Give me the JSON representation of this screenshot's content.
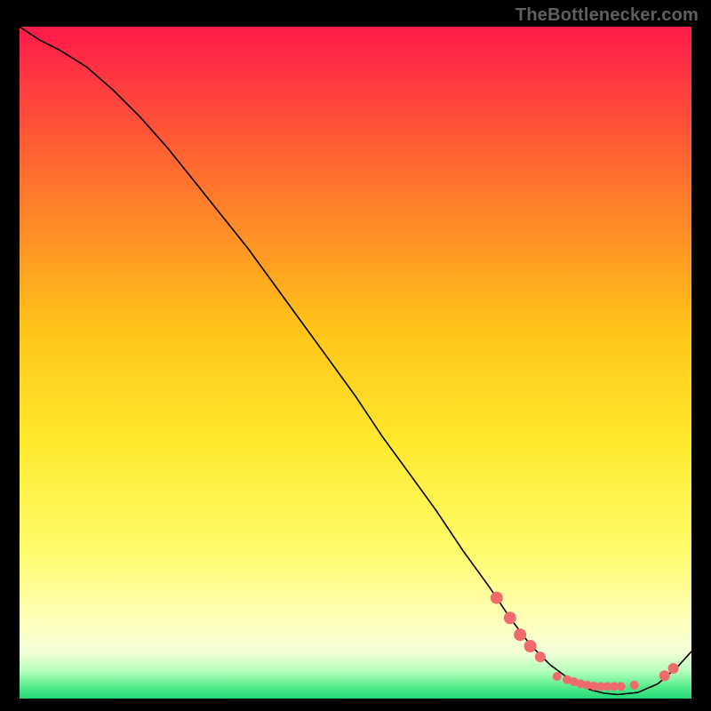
{
  "attribution": "TheBottlenecker.com",
  "chart_data": {
    "type": "line",
    "title": "",
    "xlabel": "",
    "ylabel": "",
    "xlim": [
      0,
      100
    ],
    "ylim": [
      0,
      100
    ],
    "background_gradient": {
      "top": "#ff1a4a",
      "mid1": "#ffb300",
      "mid2": "#ffe000",
      "mid3": "#ffff66",
      "mid4": "#ffffaa",
      "mid5": "#d6ffcc",
      "bottom": "#22d877"
    },
    "series": [
      {
        "name": "curve",
        "x": [
          0,
          3,
          6,
          10,
          14,
          18,
          22,
          26,
          30,
          34,
          38,
          42,
          46,
          50,
          54,
          58,
          62,
          66,
          70,
          73,
          76,
          79,
          81,
          83,
          85,
          87,
          89,
          92,
          95,
          98,
          100
        ],
        "y": [
          100,
          98,
          96.5,
          94,
          90.5,
          86.5,
          82,
          77,
          72,
          67,
          61.5,
          56,
          50.5,
          45,
          39,
          33.5,
          28,
          22,
          16.5,
          12,
          8,
          5,
          3.5,
          2.2,
          1.3,
          0.8,
          0.6,
          0.9,
          2.2,
          4.8,
          7
        ]
      }
    ],
    "markers": [
      {
        "x": 71,
        "y": 15,
        "r": 7
      },
      {
        "x": 73,
        "y": 12,
        "r": 7
      },
      {
        "x": 74.5,
        "y": 9.5,
        "r": 7
      },
      {
        "x": 76,
        "y": 7.8,
        "r": 7
      },
      {
        "x": 77.5,
        "y": 6.2,
        "r": 6
      },
      {
        "x": 80,
        "y": 3.3,
        "r": 5
      },
      {
        "x": 81.5,
        "y": 2.8,
        "r": 5
      },
      {
        "x": 82.5,
        "y": 2.5,
        "r": 5
      },
      {
        "x": 83.5,
        "y": 2.2,
        "r": 5
      },
      {
        "x": 84.5,
        "y": 2.0,
        "r": 5
      },
      {
        "x": 85.5,
        "y": 1.85,
        "r": 5
      },
      {
        "x": 86.5,
        "y": 1.8,
        "r": 5
      },
      {
        "x": 87.5,
        "y": 1.8,
        "r": 5
      },
      {
        "x": 88.5,
        "y": 1.8,
        "r": 5
      },
      {
        "x": 89.5,
        "y": 1.8,
        "r": 5
      },
      {
        "x": 91.5,
        "y": 2.0,
        "r": 5
      },
      {
        "x": 96,
        "y": 3.4,
        "r": 6
      },
      {
        "x": 97.3,
        "y": 4.5,
        "r": 6
      }
    ]
  }
}
